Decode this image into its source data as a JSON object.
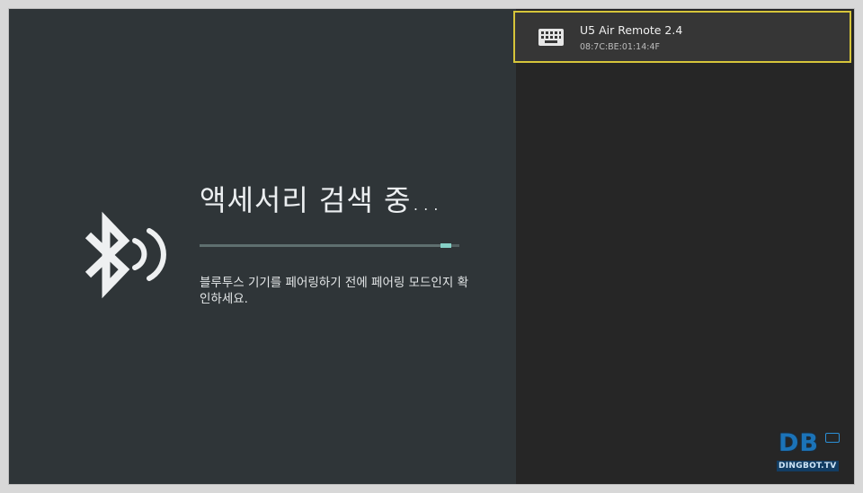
{
  "search": {
    "title": "액세서리 검색 중...",
    "hint": "블루투스 기기를 페어링하기 전에 페어링 모드인지 확인하세요.",
    "progress_fraction": 0.97
  },
  "device_list": [
    {
      "name": "U5 Air Remote 2.4",
      "address": "08:7C:BE:01:14:4F",
      "icon": "keyboard-icon",
      "selected": true
    }
  ],
  "watermark": {
    "logo_text": "DB",
    "site_text": "DINGBOT.TV"
  },
  "colors": {
    "left_panel": "#2f3538",
    "right_panel": "#262626",
    "focus_border": "#d6c53a",
    "progress_accent": "#86d0c6"
  }
}
